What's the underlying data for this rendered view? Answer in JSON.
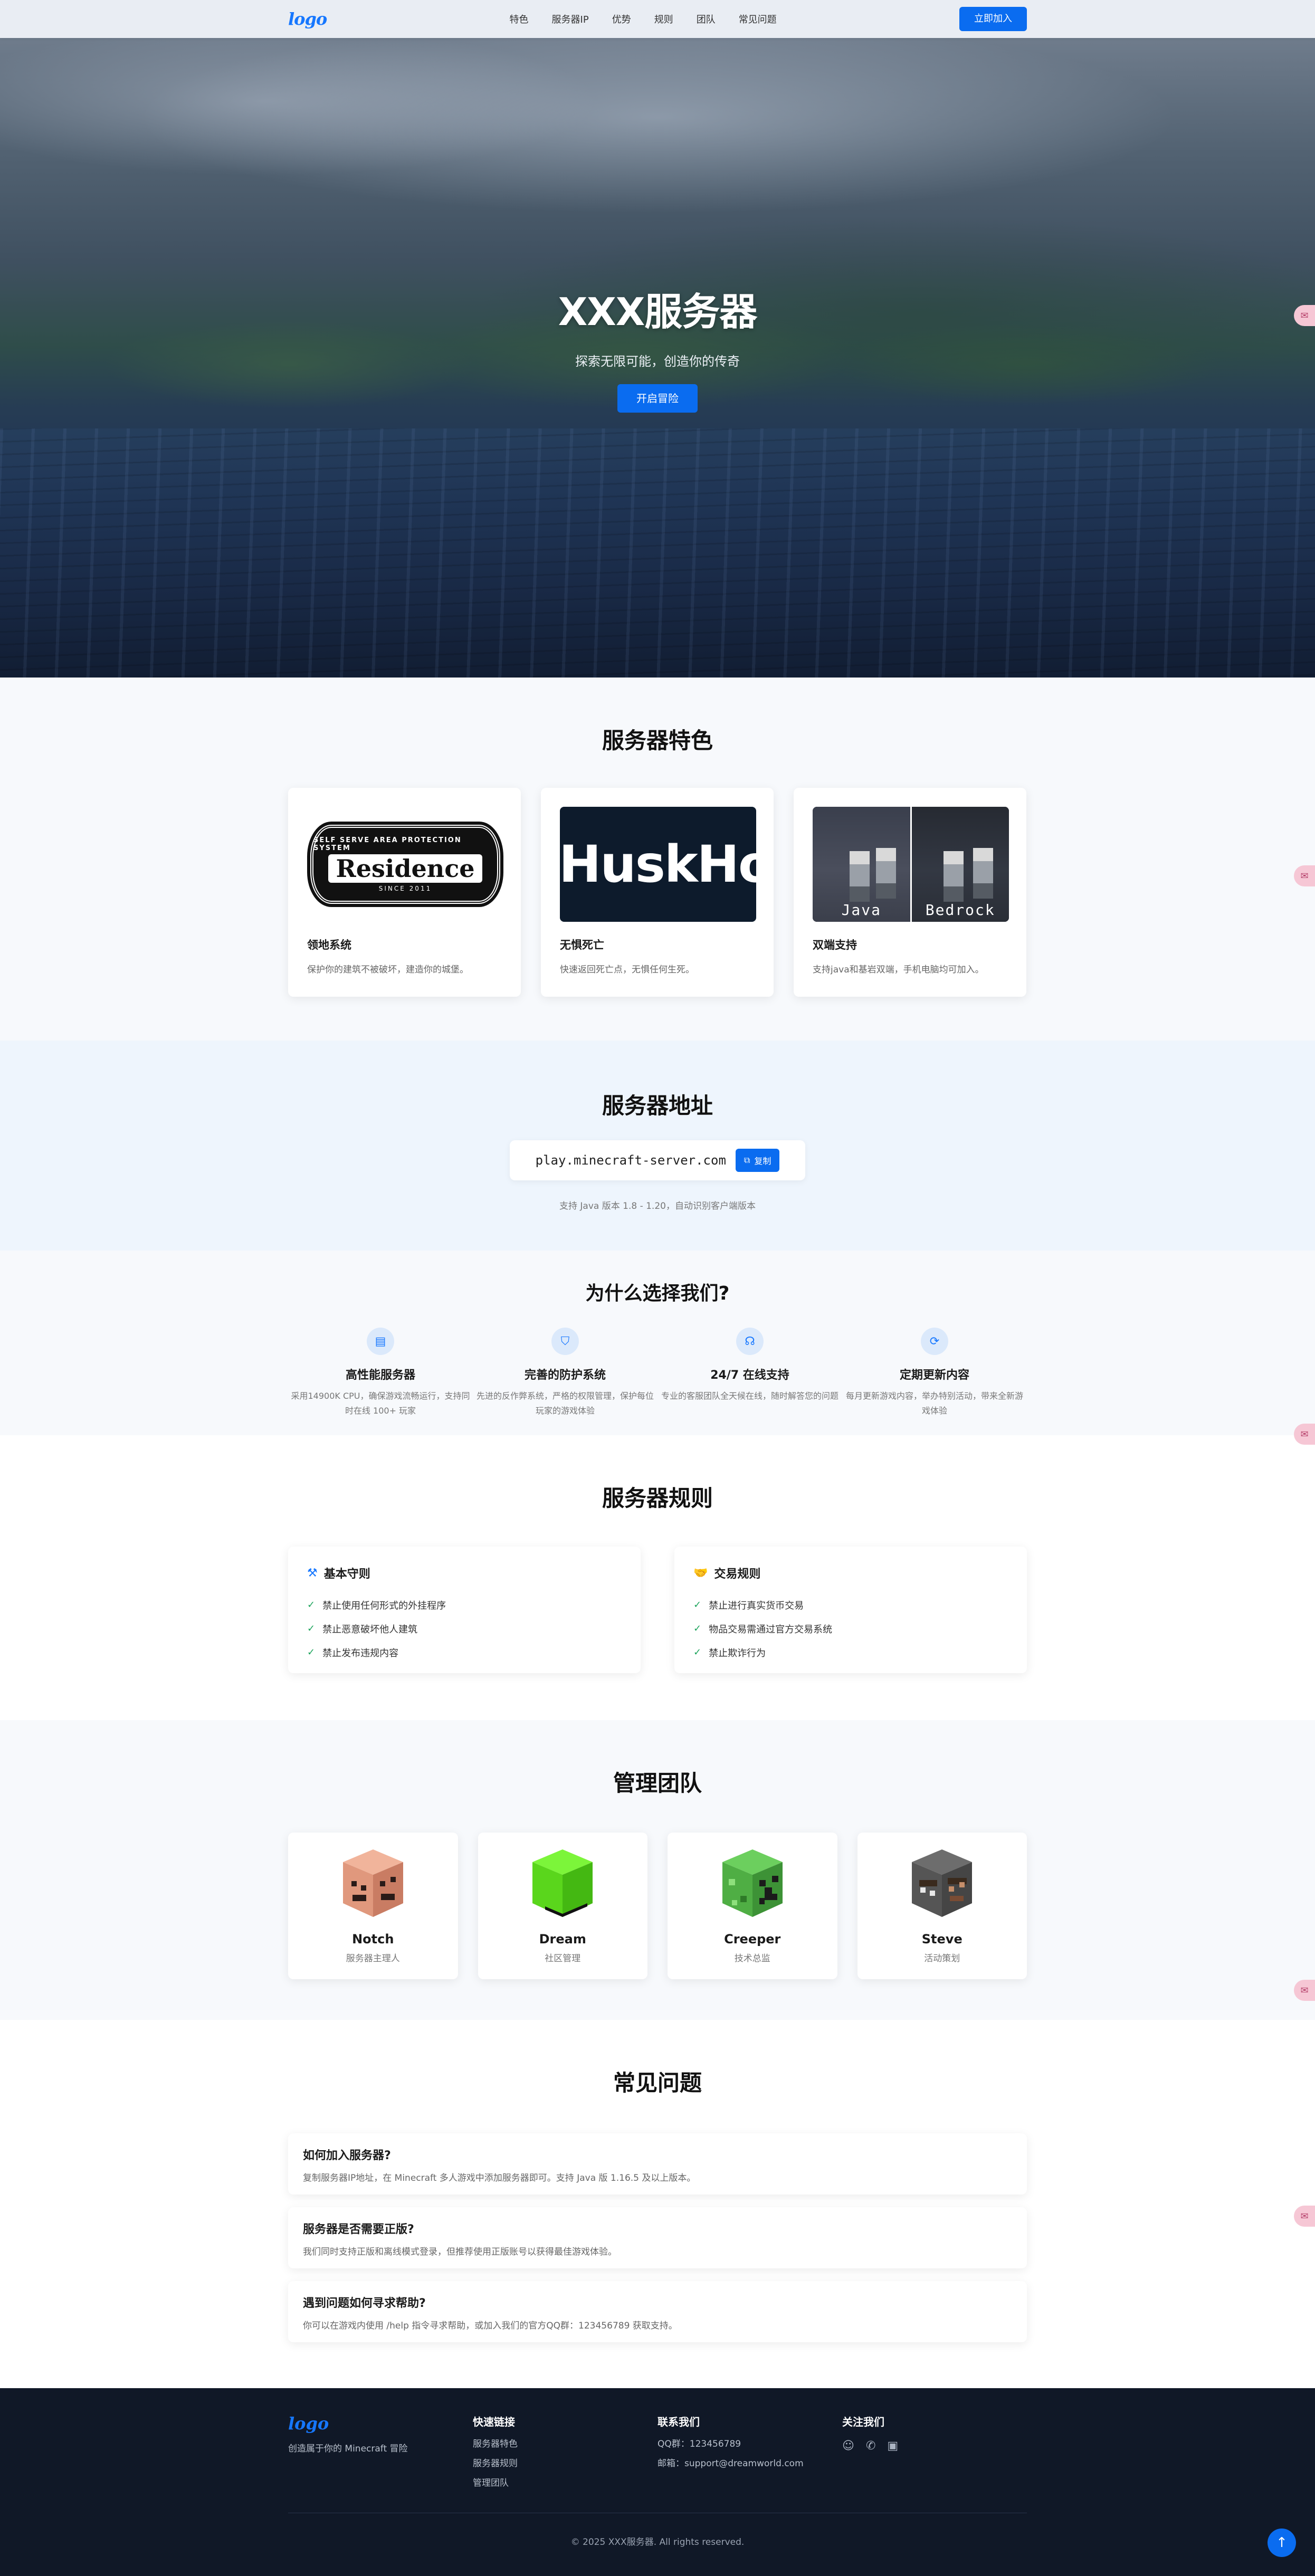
{
  "nav": {
    "logo": "logo",
    "links": [
      "特色",
      "服务器IP",
      "优势",
      "规则",
      "团队",
      "常见问题"
    ],
    "join_label": "立即加入"
  },
  "hero": {
    "title": "XXX服务器",
    "subtitle": "探索无限可能，创造你的传奇",
    "cta_label": "开启冒险"
  },
  "features": {
    "title": "服务器特色",
    "cards": [
      {
        "name": "领地系统",
        "desc": "保护你的建筑不被破坏，建造你的城堡。",
        "image_text": "Residence",
        "image_top": "SELF SERVE AREA PROTECTION SYSTEM",
        "image_bottom": "SINCE 2011"
      },
      {
        "name": "无惧死亡",
        "desc": "快速返回死亡点，无惧任何生死。",
        "image_text": "HuskHo"
      },
      {
        "name": "双端支持",
        "desc": "支持java和基岩双端，手机电脑均可加入。",
        "image_left": "Java",
        "image_right": "Bedrock"
      }
    ]
  },
  "server_ip": {
    "title": "服务器地址",
    "address": "play.minecraft-server.com",
    "copy_label": "复制",
    "note": "支持 Java 版本 1.8 - 1.20，自动识别客户端版本"
  },
  "why": {
    "title": "为什么选择我们?",
    "items": [
      {
        "icon": "server-icon",
        "title": "高性能服务器",
        "desc": "采用14900K CPU，确保游戏流畅运行，支持同时在线 100+ 玩家"
      },
      {
        "icon": "shield-icon",
        "title": "完善的防护系统",
        "desc": "先进的反作弊系统，严格的权限管理，保护每位玩家的游戏体验"
      },
      {
        "icon": "headset-icon",
        "title": "24/7 在线支持",
        "desc": "专业的客服团队全天候在线，随时解答您的问题"
      },
      {
        "icon": "refresh-icon",
        "title": "定期更新内容",
        "desc": "每月更新游戏内容，举办特别活动，带来全新游戏体验"
      }
    ]
  },
  "rules": {
    "title": "服务器规则",
    "groups": [
      {
        "title": "基本守则",
        "icon": "gavel-icon",
        "items": [
          "禁止使用任何形式的外挂程序",
          "禁止恶意破坏他人建筑",
          "禁止发布违规内容"
        ]
      },
      {
        "title": "交易规则",
        "icon": "handshake-icon",
        "items": [
          "禁止进行真实货币交易",
          "物品交易需通过官方交易系统",
          "禁止欺诈行为"
        ]
      }
    ]
  },
  "team": {
    "title": "管理团队",
    "members": [
      {
        "name": "Notch",
        "role": "服务器主理人",
        "color": "#e9a58c"
      },
      {
        "name": "Dream",
        "role": "社区管理",
        "color": "#59e01c"
      },
      {
        "name": "Creeper",
        "role": "技术总监",
        "color": "#4caf50"
      },
      {
        "name": "Steve",
        "role": "活动策划",
        "color": "#5a5a5a"
      }
    ]
  },
  "faq": {
    "title": "常见问题",
    "items": [
      {
        "q": "如何加入服务器?",
        "a": "复制服务器IP地址，在 Minecraft 多人游戏中添加服务器即可。支持 Java 版 1.16.5 及以上版本。"
      },
      {
        "q": "服务器是否需要正版?",
        "a": "我们同时支持正版和离线模式登录，但推荐使用正版账号以获得最佳游戏体验。"
      },
      {
        "q": "遇到问题如何寻求帮助?",
        "a": "你可以在游戏内使用 /help 指令寻求帮助，或加入我们的官方QQ群：123456789 获取支持。"
      }
    ]
  },
  "footer": {
    "logo": "logo",
    "tagline": "创造属于你的 Minecraft 冒险",
    "quick_title": "快速链接",
    "quick_links": [
      "服务器特色",
      "服务器规则",
      "管理团队"
    ],
    "contact_title": "联系我们",
    "qq": "QQ群：123456789",
    "email": "邮箱：support@dreamworld.com",
    "follow_title": "关注我们",
    "copyright": "© 2025 XXX服务器. All rights reserved."
  }
}
